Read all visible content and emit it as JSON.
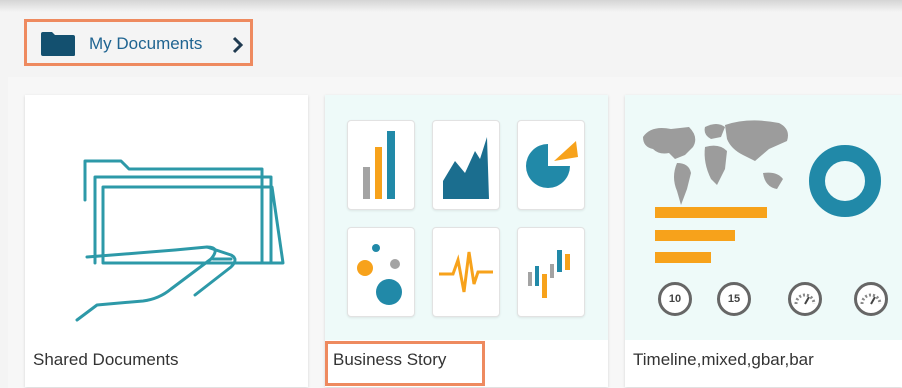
{
  "breadcrumb": {
    "label": "My Documents"
  },
  "cards": [
    {
      "title": "Shared Documents"
    },
    {
      "title": "Business Story"
    },
    {
      "title": "Timeline,mixed,gbar,bar"
    }
  ],
  "gauges": [
    "10",
    "15",
    "",
    ""
  ],
  "colors": {
    "accent_border": "#ee8a5f",
    "link": "#1f6491",
    "teal": "#2189a8",
    "orange": "#f7a21b",
    "grey": "#a3a3a3"
  }
}
